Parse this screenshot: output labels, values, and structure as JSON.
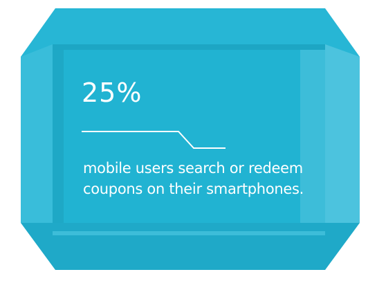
{
  "stat_card": {
    "value": "25%",
    "description": "mobile users search or redeem coupons on their smartphones.",
    "colors": {
      "panel": "#21b3d2",
      "inner_panel": "#1aa9c8",
      "side_band": "#45c1dc",
      "light_band": "#52c6df",
      "text": "#ffffff"
    }
  }
}
